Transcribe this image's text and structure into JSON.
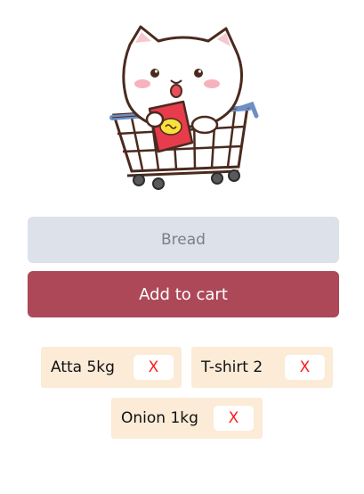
{
  "mascot": {
    "icon": "cat-in-shopping-cart-illustration"
  },
  "form": {
    "input_value": "",
    "input_placeholder": "Bread",
    "add_button_label": "Add to cart"
  },
  "cart": {
    "items": [
      {
        "label": "Atta 5kg",
        "remove_label": "X"
      },
      {
        "label": "T-shirt 2",
        "remove_label": "X"
      },
      {
        "label": "Onion 1kg",
        "remove_label": "X"
      }
    ]
  },
  "colors": {
    "input_bg": "#dce1ea",
    "button_bg": "#ac4858",
    "chip_bg": "#fbebd7",
    "remove_text": "#ff1a1a"
  }
}
